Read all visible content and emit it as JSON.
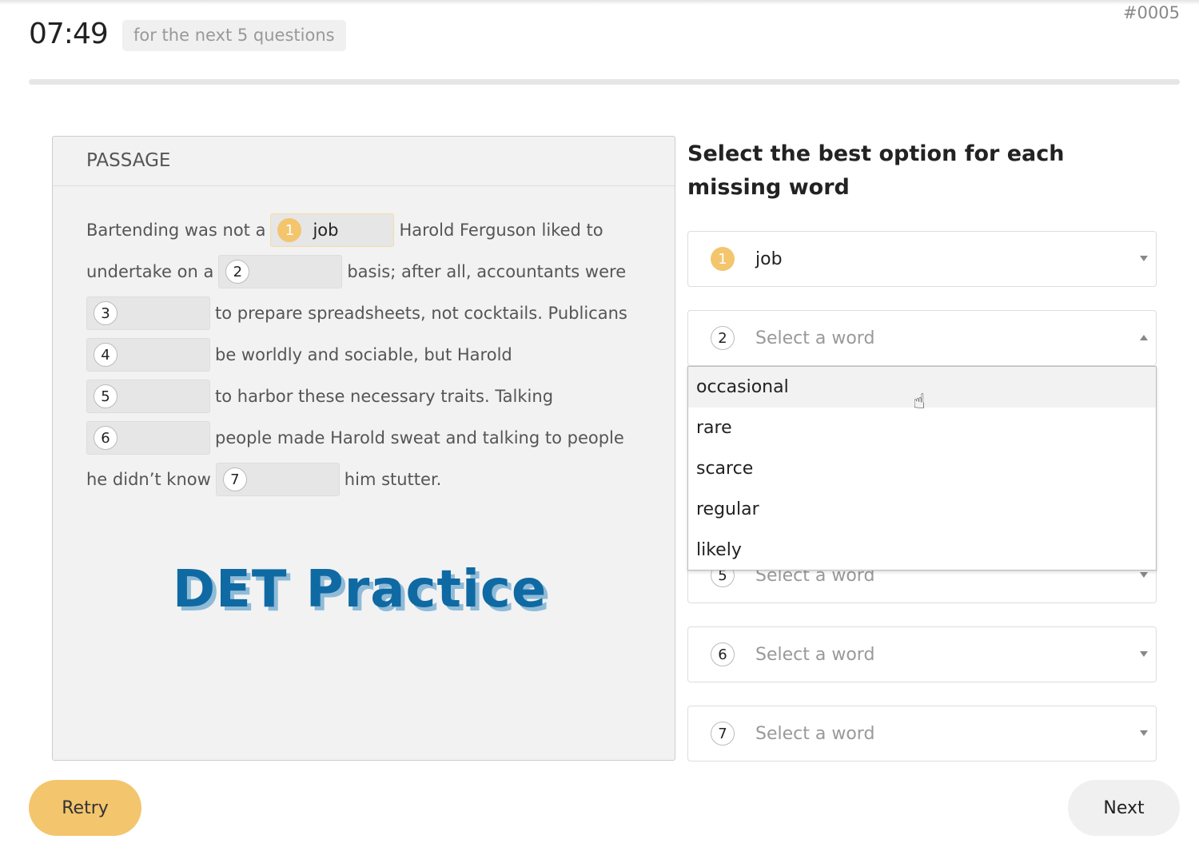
{
  "header": {
    "timer": "07:49",
    "hint": "for the next 5 questions",
    "question_id": "#0005",
    "progress": 0
  },
  "passage": {
    "heading": "PASSAGE",
    "lines": [
      {
        "pre": "Bartending was not a",
        "blank": "1",
        "value": "job",
        "post": "Harold Ferguson liked to"
      },
      {
        "pre": "undertake on a",
        "blank": "2",
        "value": "",
        "post": "basis; after all, accountants were"
      },
      {
        "pre": "",
        "blank": "3",
        "value": "",
        "post": "to prepare spreadsheets, not cocktails. Publicans"
      },
      {
        "pre": "",
        "blank": "4",
        "value": "",
        "post": "be worldly and sociable, but Harold"
      },
      {
        "pre": "",
        "blank": "5",
        "value": "",
        "post": "to harbor these necessary traits. Talking"
      },
      {
        "pre": "",
        "blank": "6",
        "value": "",
        "post": "people made Harold sweat and talking to people"
      },
      {
        "pre": "he didn’t know",
        "blank": "7",
        "value": "",
        "post": "him stutter."
      }
    ]
  },
  "watermark": "DET Practice",
  "instructions": "Select the best option for each missing word",
  "dropdowns": [
    {
      "num": "1",
      "value": "job",
      "placeholder": ""
    },
    {
      "num": "2",
      "value": "",
      "placeholder": "Select a word",
      "open": true
    },
    {
      "num": "5",
      "value": "",
      "placeholder": "Select a word"
    },
    {
      "num": "6",
      "value": "",
      "placeholder": "Select a word"
    },
    {
      "num": "7",
      "value": "",
      "placeholder": "Select a word"
    }
  ],
  "menu_options": [
    "occasional",
    "rare",
    "scarce",
    "regular",
    "likely"
  ],
  "buttons": {
    "retry": "Retry",
    "next": "Next"
  },
  "colors": {
    "accent": "#f3c56d",
    "logo": "#0f6aa3"
  }
}
